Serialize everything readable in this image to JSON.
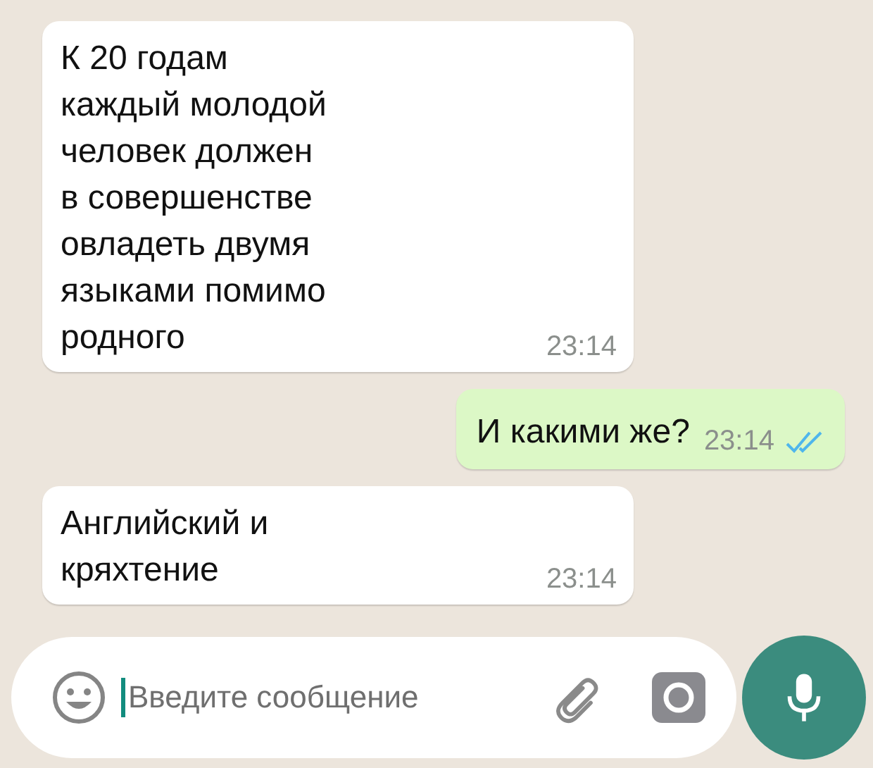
{
  "messages": [
    {
      "kind": "incoming",
      "text": "К 20 годам\nкаждый молодой\nчеловек должен\nв совершенстве\nовладеть двумя\nязыками помимо\nродного",
      "time": "23:14"
    },
    {
      "kind": "outgoing",
      "text": "И какими же?",
      "time": "23:14",
      "read": true
    },
    {
      "kind": "incoming",
      "text": "Английский и\nкряхтение",
      "time": "23:14"
    }
  ],
  "composer": {
    "placeholder": "Введите сообщение"
  }
}
